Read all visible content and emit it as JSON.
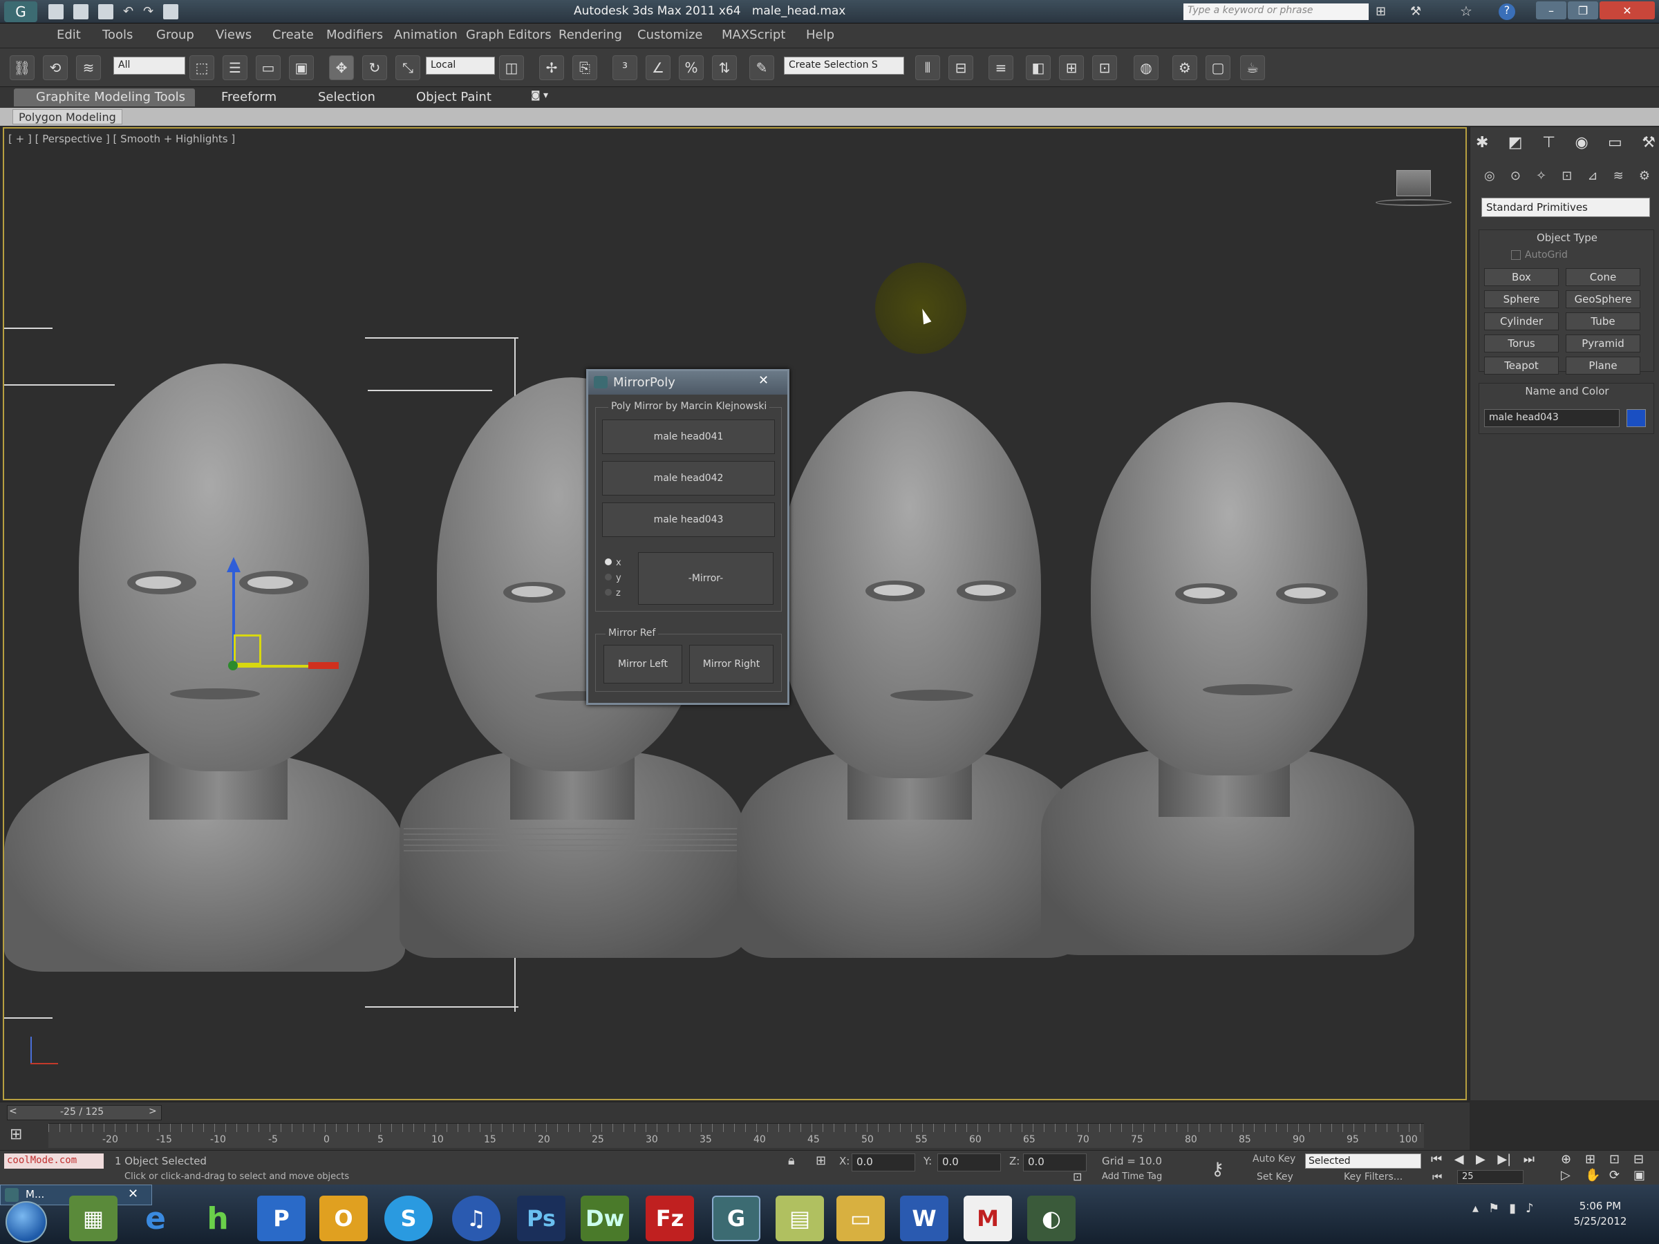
{
  "app": {
    "title": "Autodesk 3ds Max  2011 x64",
    "file": "male_head.max",
    "search_placeholder": "Type a keyword or phrase"
  },
  "menu": [
    "Edit",
    "Tools",
    "Group",
    "Views",
    "Create",
    "Modifiers",
    "Animation",
    "Graph Editors",
    "Rendering",
    "Customize",
    "MAXScript",
    "Help"
  ],
  "toolbar": {
    "selection_filter": "All",
    "ref_coord": "Local",
    "named_selection": "Create Selection S"
  },
  "ribbon": {
    "tabs": [
      "Graphite Modeling Tools",
      "Freeform",
      "Selection",
      "Object Paint"
    ],
    "panel": "Polygon Modeling"
  },
  "viewport": {
    "label": "[ + ] [ Perspective ] [ Smooth + Highlights ]"
  },
  "dialog": {
    "title": "MirrorPoly",
    "group1": "Poly Mirror by Marcin Klejnowski",
    "objects": [
      "male head041",
      "male head042",
      "male head043"
    ],
    "axes": [
      "x",
      "y",
      "z"
    ],
    "mirror_button": "-Mirror-",
    "group2": "Mirror Ref",
    "mirror_left": "Mirror Left",
    "mirror_right": "Mirror Right"
  },
  "command_panel": {
    "category": "Standard Primitives",
    "object_type_title": "Object Type",
    "autogrid": "AutoGrid",
    "primitives": [
      "Box",
      "Cone",
      "Sphere",
      "GeoSphere",
      "Cylinder",
      "Tube",
      "Torus",
      "Pyramid",
      "Teapot",
      "Plane"
    ],
    "name_color_title": "Name and Color",
    "object_name": "male head043",
    "object_color": "#1a4fc2"
  },
  "timeline": {
    "frame_display": "-25 / 125",
    "ticks": [
      "-20",
      "-15",
      "-10",
      "-5",
      "0",
      "5",
      "10",
      "15",
      "20",
      "25",
      "30",
      "35",
      "40",
      "45",
      "50",
      "55",
      "60",
      "65",
      "70",
      "75",
      "80",
      "85",
      "90",
      "95",
      "100"
    ]
  },
  "status": {
    "maxscript": "coolMode.com",
    "selected": "1 Object Selected",
    "prompt": "Click or click-and-drag to select and move objects",
    "x_label": "X:",
    "x": "0.0",
    "y_label": "Y:",
    "y": "0.0",
    "z_label": "Z:",
    "z": "0.0",
    "grid": "Grid = 10.0",
    "add_time_tag": "Add Time Tag",
    "auto_key": "Auto Key",
    "set_key": "Set Key",
    "key_mode": "Selected",
    "key_filters": "Key Filters...",
    "frame": "25"
  },
  "taskbar": {
    "time": "5:06 PM",
    "date": "5/25/2012",
    "active_window": "M..."
  }
}
